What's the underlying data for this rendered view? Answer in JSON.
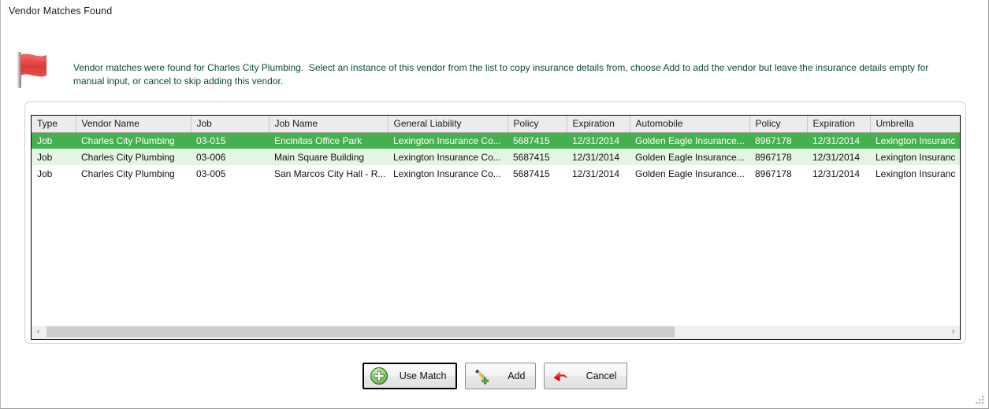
{
  "window": {
    "title": "Vendor Matches Found"
  },
  "icons": {
    "flag": "red-flag-icon",
    "resize_grip": "resize-grip-icon"
  },
  "message": {
    "text": "Vendor matches were found for Charles City Plumbing.  Select an instance of this vendor from the list to copy insurance details from, choose Add to add the vendor but leave the insurance details empty for manual input, or cancel to skip adding this vendor."
  },
  "grid": {
    "columns": [
      "Type",
      "Vendor Name",
      "Job",
      "Job Name",
      "General Liability",
      "Policy",
      "Expiration",
      "Automobile",
      "Policy",
      "Expiration",
      "Umbrella"
    ],
    "rows": [
      {
        "selected": true,
        "cells": [
          "Job",
          "Charles City Plumbing",
          "03-015",
          "Encinitas Office Park",
          "Lexington Insurance Co...",
          "5687415",
          "12/31/2014",
          "Golden Eagle Insurance...",
          "8967178",
          "12/31/2014",
          "Lexington Insuranc"
        ]
      },
      {
        "selected": false,
        "cells": [
          "Job",
          "Charles City Plumbing",
          "03-006",
          "Main Square Building",
          "Lexington Insurance Co...",
          "5687415",
          "12/31/2014",
          "Golden Eagle Insurance...",
          "8967178",
          "12/31/2014",
          "Lexington Insuranc"
        ]
      },
      {
        "selected": false,
        "cells": [
          "Job",
          "Charles City Plumbing",
          "03-005",
          "San Marcos City Hall - R...",
          "Lexington Insurance Co...",
          "5687415",
          "12/31/2014",
          "Golden Eagle Insurance...",
          "8967178",
          "12/31/2014",
          "Lexington Insuranc"
        ]
      }
    ]
  },
  "scrollbar": {
    "left_arrow": "‹",
    "right_arrow": "›"
  },
  "buttons": {
    "use_match": {
      "label": "Use Match",
      "icon": "green-plus-circle-icon"
    },
    "add": {
      "label": "Add",
      "icon": "pencil-plus-icon"
    },
    "cancel": {
      "label": "Cancel",
      "icon": "red-back-arrow-icon"
    }
  },
  "colors": {
    "selected_row": "#45b04e",
    "alt_row": "#e4f5e4",
    "header": "#ececec",
    "text_message": "#0c4a3e",
    "flag_red": "#e04343",
    "cancel_red": "#d41f1f",
    "plus_green": "#3fa03f"
  }
}
